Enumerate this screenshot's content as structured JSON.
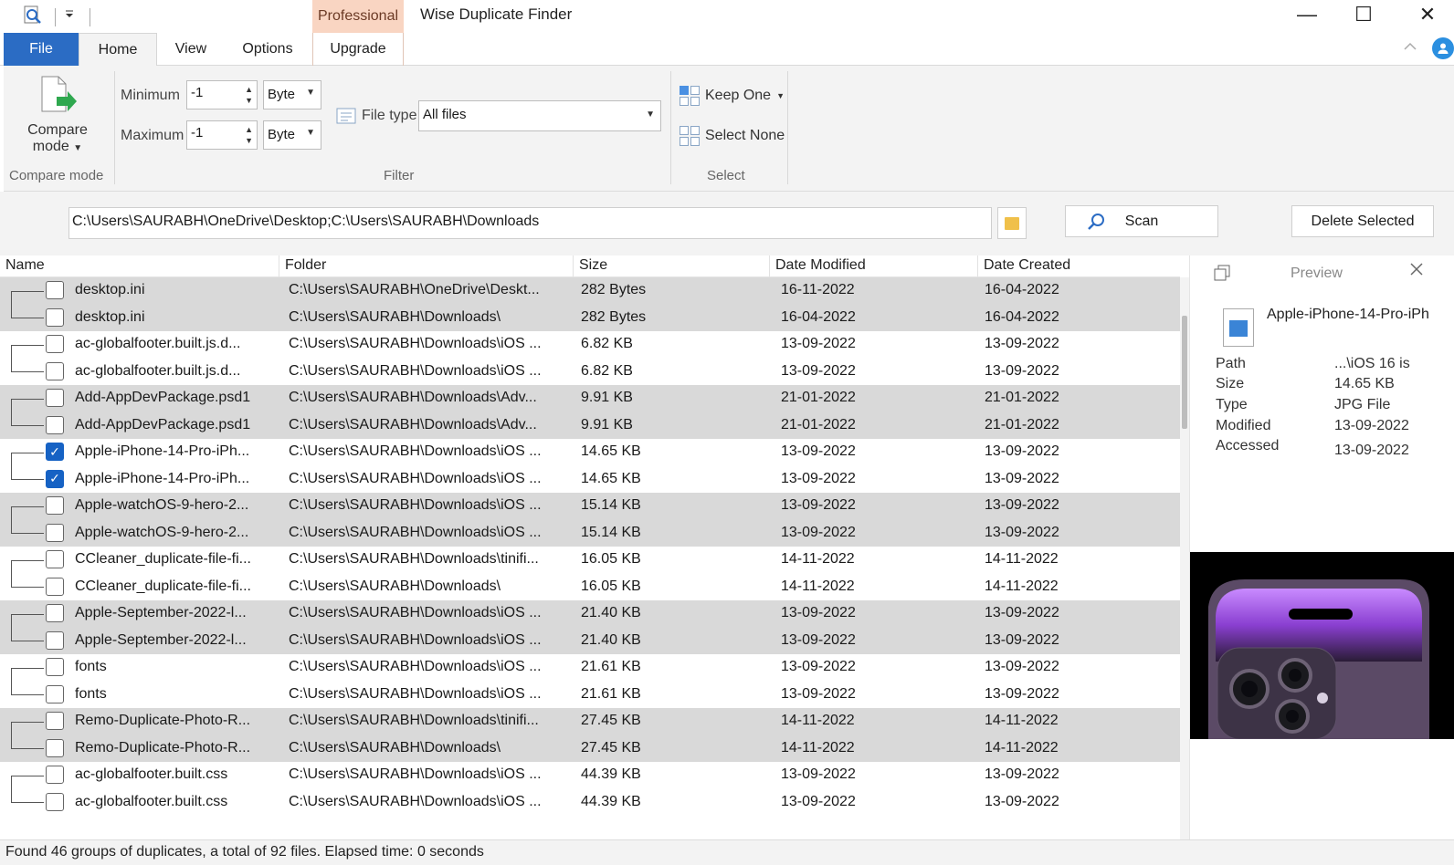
{
  "window": {
    "title": "Wise Duplicate Finder",
    "professional_label": "Professional",
    "minimize": "—",
    "maximize": "☐",
    "close": "✕"
  },
  "tabs": {
    "file": "File",
    "home": "Home",
    "view": "View",
    "options": "Options",
    "upgrade": "Upgrade"
  },
  "ribbon": {
    "compare_mode": {
      "line1": "Compare",
      "line2": "mode",
      "group_label": "Compare mode"
    },
    "filter": {
      "minimum_label": "Minimum",
      "maximum_label": "Maximum",
      "minimum_value": "-1",
      "maximum_value": "-1",
      "min_unit": "Byte",
      "max_unit": "Byte",
      "file_type_label": "File type",
      "file_type_value": "All files",
      "group_label": "Filter"
    },
    "select": {
      "keep_one": "Keep One",
      "select_none": "Select None",
      "group_label": "Select"
    }
  },
  "pathbar": {
    "path": "C:\\Users\\SAURABH\\OneDrive\\Desktop;C:\\Users\\SAURABH\\Downloads",
    "scan": "Scan",
    "delete_selected": "Delete Selected"
  },
  "table": {
    "headers": [
      "Name",
      "Folder",
      "Size",
      "Date Modified",
      "Date Created"
    ],
    "groups": [
      {
        "shade": true,
        "rows": [
          {
            "checked": false,
            "name": "desktop.ini",
            "folder": "C:\\Users\\SAURABH\\OneDrive\\Deskt...",
            "size": "282 Bytes",
            "modified": "16-11-2022",
            "created": "16-04-2022"
          },
          {
            "checked": false,
            "name": "desktop.ini",
            "folder": "C:\\Users\\SAURABH\\Downloads\\",
            "size": "282 Bytes",
            "modified": "16-04-2022",
            "created": "16-04-2022"
          }
        ]
      },
      {
        "shade": false,
        "rows": [
          {
            "checked": false,
            "name": "ac-globalfooter.built.js.d...",
            "folder": "C:\\Users\\SAURABH\\Downloads\\iOS ...",
            "size": "6.82 KB",
            "modified": "13-09-2022",
            "created": "13-09-2022"
          },
          {
            "checked": false,
            "name": "ac-globalfooter.built.js.d...",
            "folder": "C:\\Users\\SAURABH\\Downloads\\iOS ...",
            "size": "6.82 KB",
            "modified": "13-09-2022",
            "created": "13-09-2022"
          }
        ]
      },
      {
        "shade": true,
        "rows": [
          {
            "checked": false,
            "name": "Add-AppDevPackage.psd1",
            "folder": "C:\\Users\\SAURABH\\Downloads\\Adv...",
            "size": "9.91 KB",
            "modified": "21-01-2022",
            "created": "21-01-2022"
          },
          {
            "checked": false,
            "name": "Add-AppDevPackage.psd1",
            "folder": "C:\\Users\\SAURABH\\Downloads\\Adv...",
            "size": "9.91 KB",
            "modified": "21-01-2022",
            "created": "21-01-2022"
          }
        ]
      },
      {
        "shade": false,
        "rows": [
          {
            "checked": true,
            "name": "Apple-iPhone-14-Pro-iPh...",
            "folder": "C:\\Users\\SAURABH\\Downloads\\iOS ...",
            "size": "14.65 KB",
            "modified": "13-09-2022",
            "created": "13-09-2022"
          },
          {
            "checked": true,
            "name": "Apple-iPhone-14-Pro-iPh...",
            "folder": "C:\\Users\\SAURABH\\Downloads\\iOS ...",
            "size": "14.65 KB",
            "modified": "13-09-2022",
            "created": "13-09-2022"
          }
        ]
      },
      {
        "shade": true,
        "rows": [
          {
            "checked": false,
            "name": "Apple-watchOS-9-hero-2...",
            "folder": "C:\\Users\\SAURABH\\Downloads\\iOS ...",
            "size": "15.14 KB",
            "modified": "13-09-2022",
            "created": "13-09-2022"
          },
          {
            "checked": false,
            "name": "Apple-watchOS-9-hero-2...",
            "folder": "C:\\Users\\SAURABH\\Downloads\\iOS ...",
            "size": "15.14 KB",
            "modified": "13-09-2022",
            "created": "13-09-2022"
          }
        ]
      },
      {
        "shade": false,
        "rows": [
          {
            "checked": false,
            "name": "CCleaner_duplicate-file-fi...",
            "folder": "C:\\Users\\SAURABH\\Downloads\\tinifi...",
            "size": "16.05 KB",
            "modified": "14-11-2022",
            "created": "14-11-2022"
          },
          {
            "checked": false,
            "name": "CCleaner_duplicate-file-fi...",
            "folder": "C:\\Users\\SAURABH\\Downloads\\",
            "size": "16.05 KB",
            "modified": "14-11-2022",
            "created": "14-11-2022"
          }
        ]
      },
      {
        "shade": true,
        "rows": [
          {
            "checked": false,
            "name": "Apple-September-2022-l...",
            "folder": "C:\\Users\\SAURABH\\Downloads\\iOS ...",
            "size": "21.40 KB",
            "modified": "13-09-2022",
            "created": "13-09-2022"
          },
          {
            "checked": false,
            "name": "Apple-September-2022-l...",
            "folder": "C:\\Users\\SAURABH\\Downloads\\iOS ...",
            "size": "21.40 KB",
            "modified": "13-09-2022",
            "created": "13-09-2022"
          }
        ]
      },
      {
        "shade": false,
        "rows": [
          {
            "checked": false,
            "name": "fonts",
            "folder": "C:\\Users\\SAURABH\\Downloads\\iOS ...",
            "size": "21.61 KB",
            "modified": "13-09-2022",
            "created": "13-09-2022"
          },
          {
            "checked": false,
            "name": "fonts",
            "folder": "C:\\Users\\SAURABH\\Downloads\\iOS ...",
            "size": "21.61 KB",
            "modified": "13-09-2022",
            "created": "13-09-2022"
          }
        ]
      },
      {
        "shade": true,
        "rows": [
          {
            "checked": false,
            "name": "Remo-Duplicate-Photo-R...",
            "folder": "C:\\Users\\SAURABH\\Downloads\\tinifi...",
            "size": "27.45 KB",
            "modified": "14-11-2022",
            "created": "14-11-2022"
          },
          {
            "checked": false,
            "name": "Remo-Duplicate-Photo-R...",
            "folder": "C:\\Users\\SAURABH\\Downloads\\",
            "size": "27.45 KB",
            "modified": "14-11-2022",
            "created": "14-11-2022"
          }
        ]
      },
      {
        "shade": false,
        "rows": [
          {
            "checked": false,
            "name": "ac-globalfooter.built.css",
            "folder": "C:\\Users\\SAURABH\\Downloads\\iOS ...",
            "size": "44.39 KB",
            "modified": "13-09-2022",
            "created": "13-09-2022"
          },
          {
            "checked": false,
            "name": "ac-globalfooter.built.css",
            "folder": "C:\\Users\\SAURABH\\Downloads\\iOS ...",
            "size": "44.39 KB",
            "modified": "13-09-2022",
            "created": "13-09-2022"
          }
        ]
      }
    ]
  },
  "preview": {
    "title": "Preview",
    "filename": "Apple-iPhone-14-Pro-iPh",
    "fields": [
      {
        "key": "Path",
        "value": "...\\iOS 16 is"
      },
      {
        "key": "Size",
        "value": "14.65 KB"
      },
      {
        "key": "Type",
        "value": "JPG File"
      },
      {
        "key": "Modified",
        "value": "13-09-2022"
      },
      {
        "key": "Accessed",
        "value": "13-09-2022"
      }
    ]
  },
  "status": {
    "text": "Found 46 groups of duplicates, a total of 92 files. Elapsed time: 0 seconds"
  },
  "colors": {
    "accent": "#2b6cc4",
    "professional_bg": "#f9d5c2",
    "row_shade": "#d9d9d9",
    "checkbox_checked": "#1662c4"
  }
}
